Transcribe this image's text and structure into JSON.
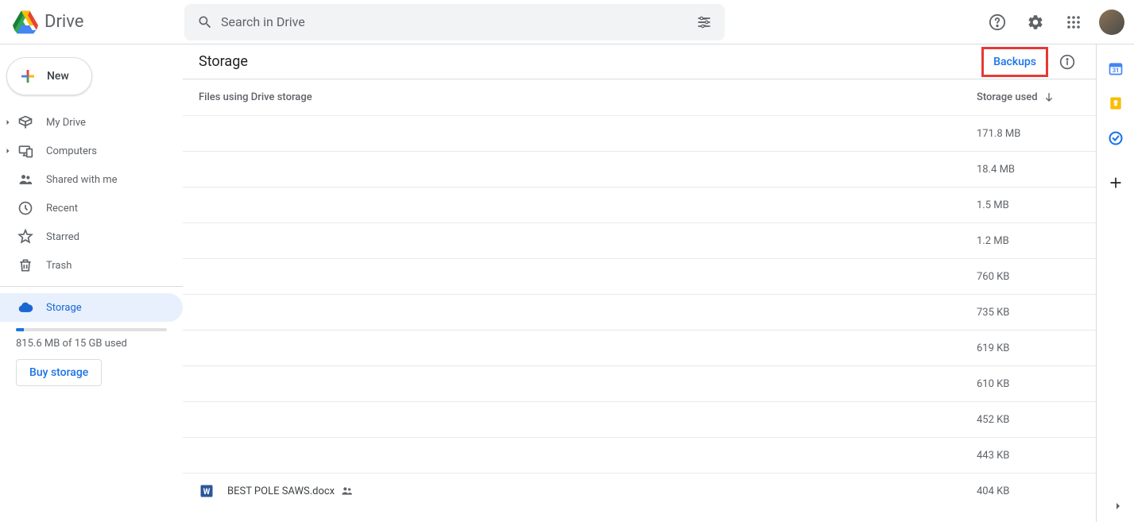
{
  "app_title": "Drive",
  "search": {
    "placeholder": "Search in Drive"
  },
  "new_button": "New",
  "sidebar": {
    "items": [
      {
        "label": "My Drive",
        "expandable": true
      },
      {
        "label": "Computers",
        "expandable": true
      },
      {
        "label": "Shared with me",
        "expandable": false
      },
      {
        "label": "Recent",
        "expandable": false
      },
      {
        "label": "Starred",
        "expandable": false
      },
      {
        "label": "Trash",
        "expandable": false
      }
    ],
    "storage_item": "Storage",
    "storage_used_text": "815.6 MB of 15 GB used",
    "buy_storage": "Buy storage"
  },
  "page": {
    "title": "Storage",
    "backups": "Backups",
    "col_file": "Files using Drive storage",
    "col_size": "Storage used"
  },
  "rows": [
    {
      "name": "",
      "size": "171.8 MB"
    },
    {
      "name": "",
      "size": "18.4 MB"
    },
    {
      "name": "",
      "size": "1.5 MB"
    },
    {
      "name": "",
      "size": "1.2 MB"
    },
    {
      "name": "",
      "size": "760 KB"
    },
    {
      "name": "",
      "size": "735 KB"
    },
    {
      "name": "",
      "size": "619 KB"
    },
    {
      "name": "",
      "size": "610 KB"
    },
    {
      "name": "",
      "size": "452 KB"
    },
    {
      "name": "",
      "size": "443 KB"
    },
    {
      "name": "BEST POLE SAWS.docx",
      "size": "404 KB",
      "icon": "word",
      "shared": true
    }
  ]
}
